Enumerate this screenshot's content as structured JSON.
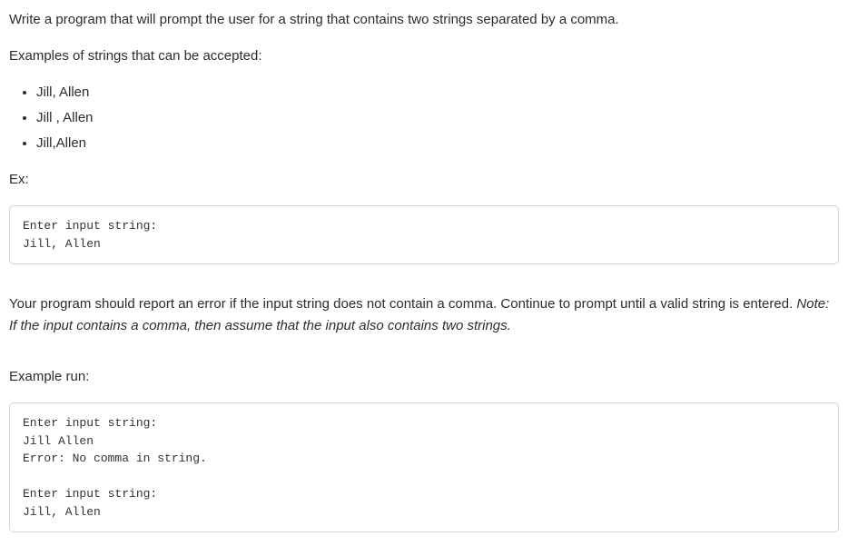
{
  "intro": "Write a program that will prompt the user for a string that contains two strings separated by a comma.",
  "examples_intro": "Examples of strings that can be accepted:",
  "example_inputs": [
    "Jill, Allen",
    "Jill , Allen",
    "Jill,Allen"
  ],
  "ex_label": "Ex:",
  "code_example_1": "Enter input string:\nJill, Allen",
  "error_paragraph_prefix": "Your program should report an error if the input string does not contain a comma. Continue to prompt until a valid string is entered. ",
  "note_text": "Note: If the input contains a comma, then assume that the input also contains two strings.",
  "example_run_label": "Example run:",
  "code_example_2": "Enter input string:\nJill Allen\nError: No comma in string.\n\nEnter input string:\nJill, Allen"
}
